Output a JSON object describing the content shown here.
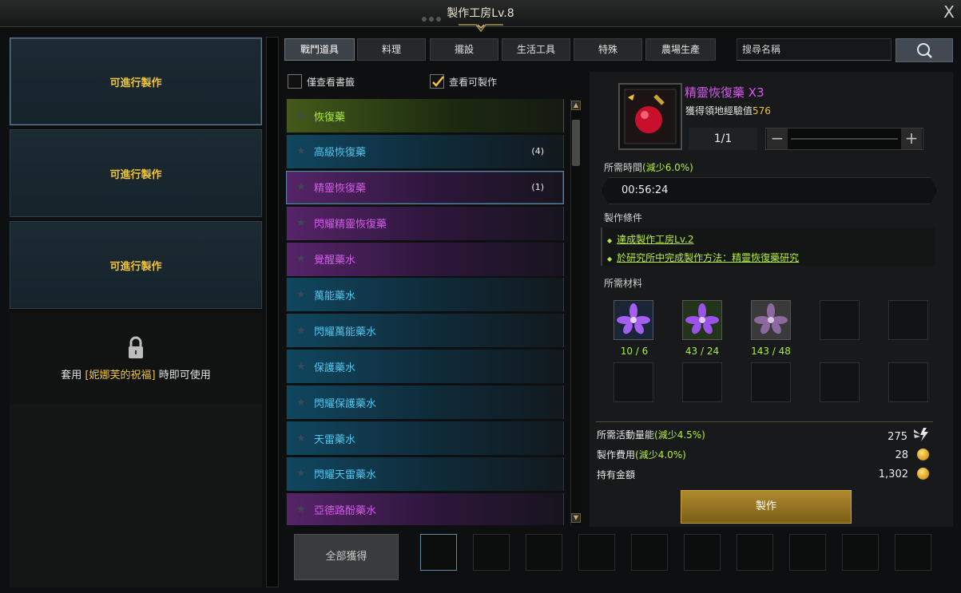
{
  "window": {
    "title": "製作工房Lv.8",
    "close": "X"
  },
  "slots": [
    {
      "label": "可進行製作"
    },
    {
      "label": "可進行製作"
    },
    {
      "label": "可進行製作"
    }
  ],
  "locked_slot": {
    "prefix": "套用 ",
    "highlight": "[妮娜芙的祝福]",
    "suffix": " 時即可使用"
  },
  "tabs": [
    "戰鬥道具",
    "料理",
    "擺設",
    "生活工具",
    "特殊",
    "農場生產"
  ],
  "search": {
    "placeholder": "搜尋名稱"
  },
  "filters": [
    {
      "label": "僅查看書籤",
      "checked": false
    },
    {
      "label": "查看可製作",
      "checked": true
    }
  ],
  "recipes": [
    {
      "name": "恢復藥",
      "count": "",
      "grade": "green"
    },
    {
      "name": "高級恢復藥",
      "count": "(4)",
      "grade": "blue"
    },
    {
      "name": "精靈恢復藥",
      "count": "(1)",
      "grade": "purple",
      "selected": true
    },
    {
      "name": "閃耀精靈恢復藥",
      "count": "",
      "grade": "purple"
    },
    {
      "name": "覺醒藥水",
      "count": "",
      "grade": "purple"
    },
    {
      "name": "萬能藥水",
      "count": "",
      "grade": "blue"
    },
    {
      "name": "閃耀萬能藥水",
      "count": "",
      "grade": "blue"
    },
    {
      "name": "保護藥水",
      "count": "",
      "grade": "blue"
    },
    {
      "name": "閃耀保護藥水",
      "count": "",
      "grade": "blue"
    },
    {
      "name": "天雷藥水",
      "count": "",
      "grade": "blue"
    },
    {
      "name": "閃耀天雷藥水",
      "count": "",
      "grade": "blue"
    },
    {
      "name": "亞德路酚藥水",
      "count": "",
      "grade": "purple"
    }
  ],
  "detail": {
    "item_name": "精靈恢復藥 X3",
    "exp_label": "獲得領地經驗值",
    "exp_value": "576",
    "quantity": "1/1",
    "time_label": "所需時間",
    "time_bonus": "(減少6.0%)",
    "time_value": "00:56:24",
    "conditions_label": "製作條件",
    "conditions": [
      "達成製作工房Lv.2",
      "於研究所中完成製作方法：精靈恢復藥研究"
    ],
    "materials_label": "所需材料",
    "materials": [
      {
        "count": "10 / 6",
        "icon": "purple-flower-icon"
      },
      {
        "count": "43 / 24",
        "icon": "purple-flower-green-bg-icon"
      },
      {
        "count": "143 / 48",
        "icon": "grey-flower-icon"
      }
    ],
    "energy_label": "所需活動量能",
    "energy_bonus": "(減少4.5%)",
    "energy_value": "275",
    "fee_label": "製作費用",
    "fee_bonus": "(減少4.0%)",
    "fee_value": "28",
    "gold_label": "持有金額",
    "gold_value": "1,302",
    "craft_button": "製作"
  },
  "bottom": {
    "collect_all": "全部獲得"
  }
}
